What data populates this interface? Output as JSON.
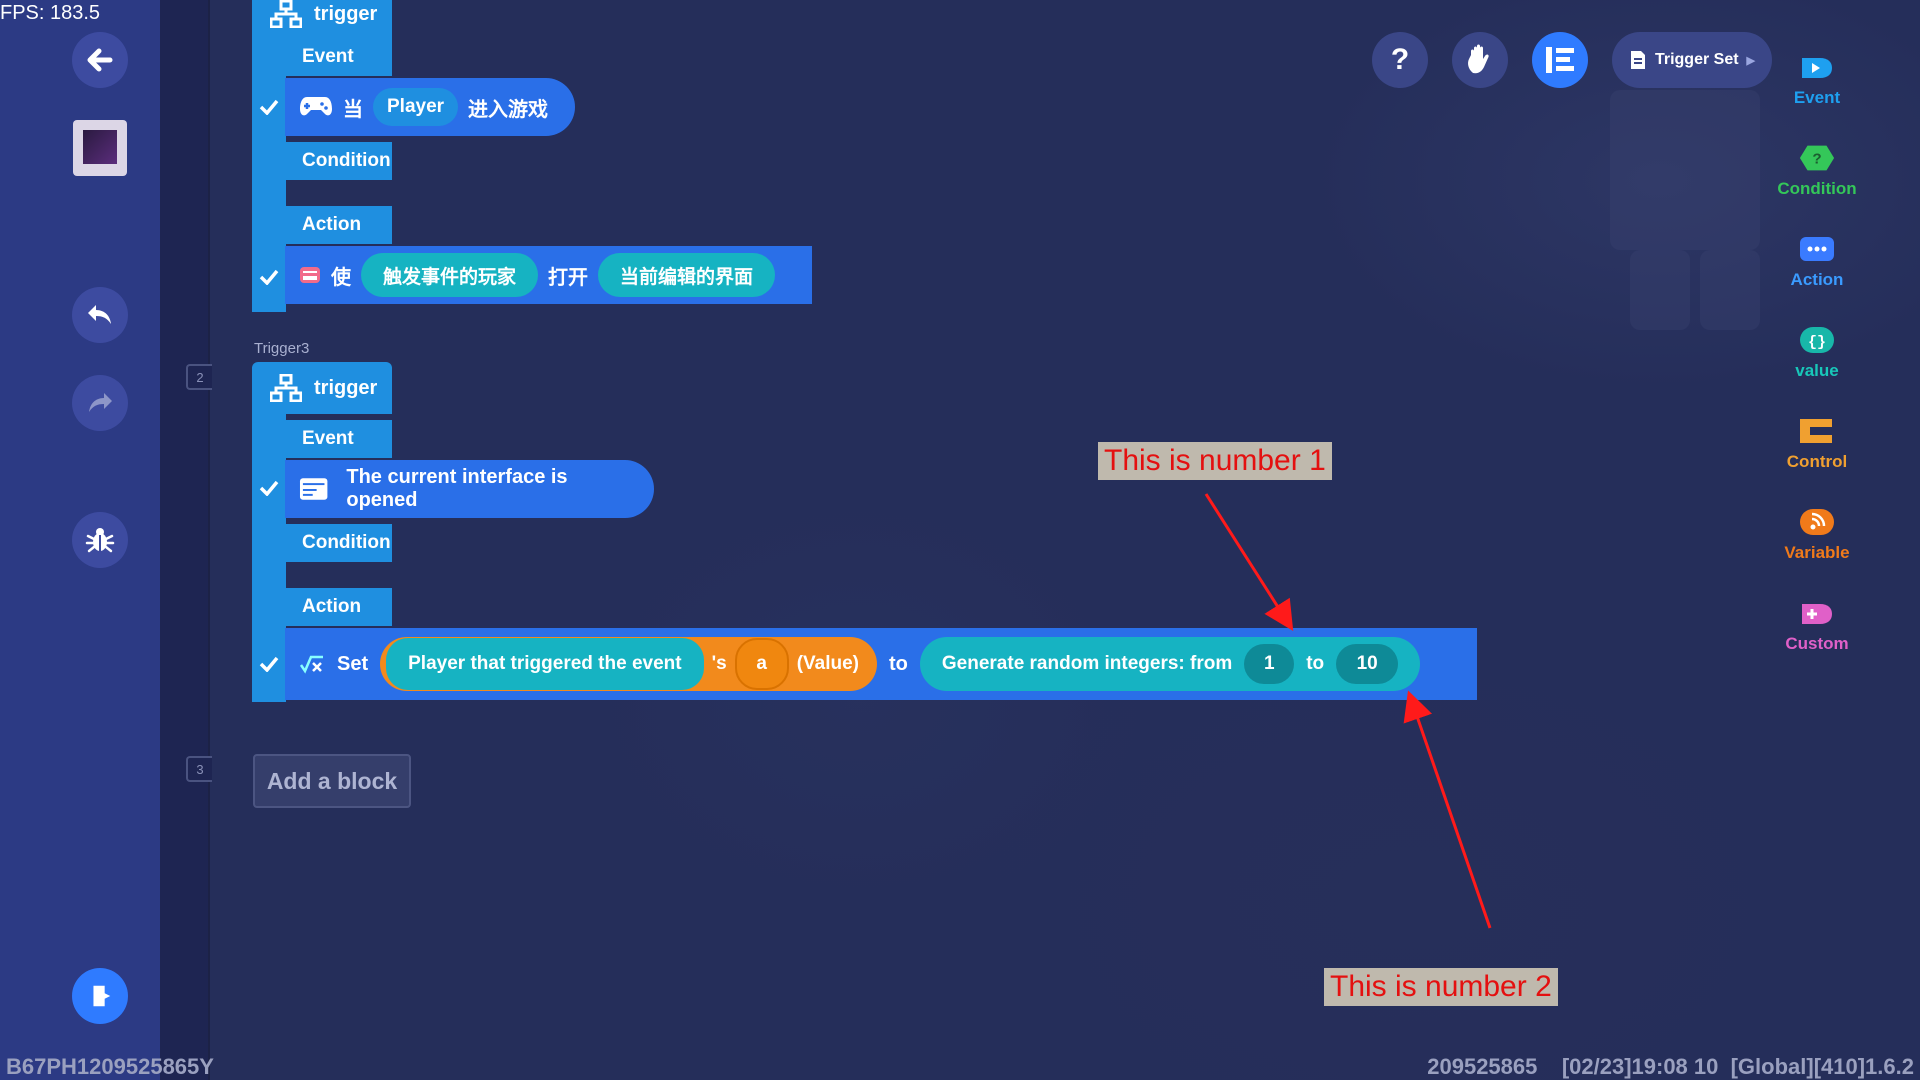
{
  "status": {
    "fps": "FPS: 183.5"
  },
  "footer": {
    "left": "B67PH1209525865Y",
    "right": "209525865    [02/23]19:08 10  [Global][410]1.6.2"
  },
  "timeline": {
    "markers": [
      "2",
      "3"
    ]
  },
  "trigger_prev": {
    "head": "trigger",
    "event": "Event",
    "event_row": {
      "p1": "当",
      "player": "Player",
      "p2": "进入游戏"
    },
    "condition": "Condition",
    "action": "Action",
    "action_row": {
      "p1": "使",
      "who": "触发事件的玩家",
      "p2": "打开",
      "target": "当前编辑的界面"
    }
  },
  "trigger3": {
    "label": "Trigger3",
    "head": "trigger",
    "event": "Event",
    "event_row": {
      "text": "The current interface is opened"
    },
    "condition": "Condition",
    "action": "Action",
    "action_row": {
      "set": "Set",
      "player": "Player that triggered the event",
      "poss": "'s",
      "var": "a",
      "value": "(Value)",
      "to": "to",
      "random": "Generate random integers: from",
      "from_val": "1",
      "to2": "to",
      "to_val": "10"
    }
  },
  "add_block": "Add a block",
  "toolbar": {
    "trigger_set": "Trigger Set"
  },
  "palette": [
    {
      "label": "Event",
      "color": "#1ea0f0"
    },
    {
      "label": "Condition",
      "color": "#34c759"
    },
    {
      "label": "Action",
      "color": "#3a7bff"
    },
    {
      "label": "value",
      "color": "#18b7a9"
    },
    {
      "label": "Control",
      "color": "#f0a030"
    },
    {
      "label": "Variable",
      "color": "#f07a1a"
    },
    {
      "label": "Custom",
      "color": "#e060c8"
    }
  ],
  "annotations": {
    "note1": "This is number 1",
    "note2": "This is number 2"
  }
}
